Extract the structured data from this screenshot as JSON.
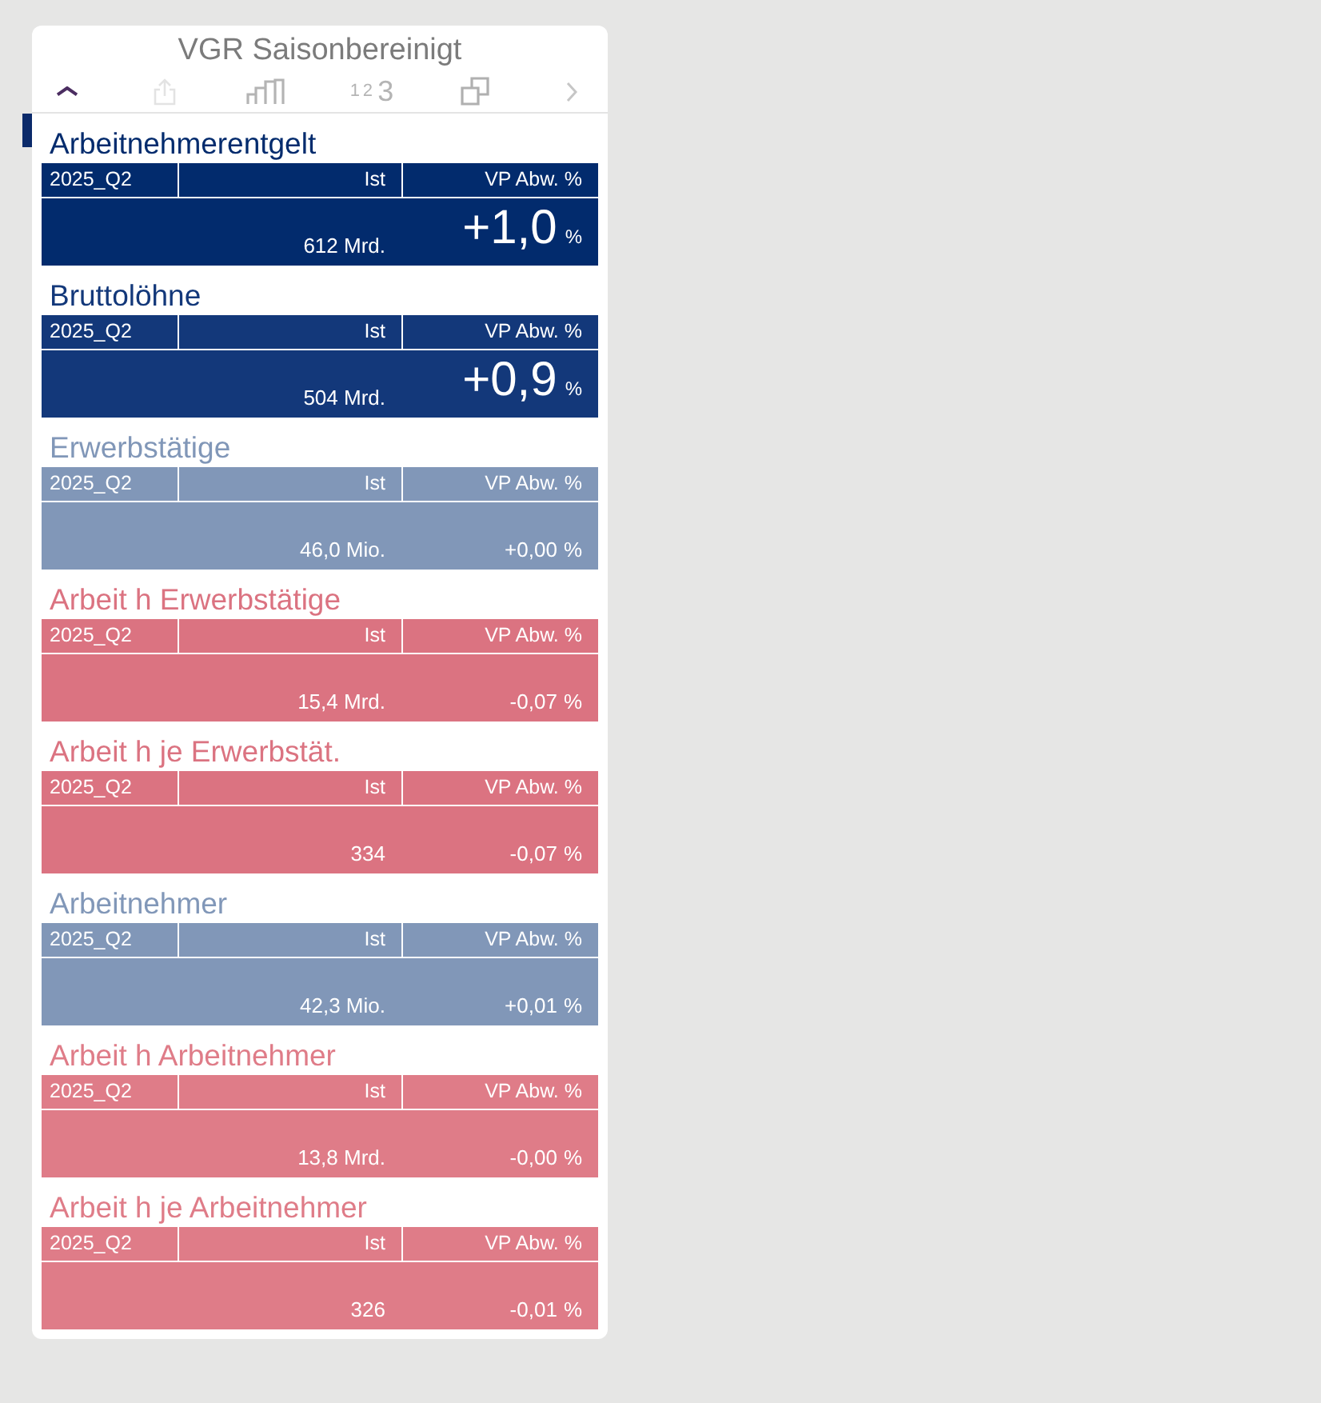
{
  "panel": {
    "title": "VGR Saisonbereinigt"
  },
  "toolbar": [
    {
      "kind": "collapse",
      "disabled": false
    },
    {
      "kind": "share",
      "disabled": true
    },
    {
      "kind": "chart",
      "disabled": false
    },
    {
      "kind": "number_format",
      "label": "$_{12}$3",
      "disabled": false
    },
    {
      "kind": "windows",
      "disabled": false
    },
    {
      "kind": "next",
      "disabled": false
    }
  ],
  "tiles": [
    {
      "title": "Arbeitnehmerentgelt",
      "color": "#022b6d",
      "selected": true,
      "emphasized": true,
      "columns": [
        "2025_Q2",
        "Ist",
        "VP Abw. %"
      ],
      "actual": "612 Mrd.",
      "deviation": "+1,0",
      "unit": "%"
    },
    {
      "title": "Bruttolöhne",
      "color": "#13387a",
      "selected": false,
      "emphasized": true,
      "columns": [
        "2025_Q2",
        "Ist",
        "VP Abw. %"
      ],
      "actual": "504 Mrd.",
      "deviation": "+0,9",
      "unit": "%"
    },
    {
      "title": "Erwerbstätige",
      "color": "#8197b8",
      "selected": false,
      "emphasized": false,
      "columns": [
        "2025_Q2",
        "Ist",
        "VP Abw. %"
      ],
      "actual": "46,0 Mio.",
      "deviation": "+0,00",
      "unit": "%"
    },
    {
      "title": "Arbeit h Erwerbstätige",
      "color": "#db7381",
      "selected": false,
      "emphasized": false,
      "columns": [
        "2025_Q2",
        "Ist",
        "VP Abw. %"
      ],
      "actual": "15,4 Mrd.",
      "deviation": "-0,07",
      "unit": "%"
    },
    {
      "title": "Arbeit h je Erwerbstät.",
      "color": "#db7381",
      "selected": false,
      "emphasized": false,
      "columns": [
        "2025_Q2",
        "Ist",
        "VP Abw. %"
      ],
      "actual": "334",
      "deviation": "-0,07",
      "unit": "%"
    },
    {
      "title": "Arbeitnehmer",
      "color": "#8197b8",
      "selected": false,
      "emphasized": false,
      "columns": [
        "2025_Q2",
        "Ist",
        "VP Abw. %"
      ],
      "actual": "42,3 Mio.",
      "deviation": "+0,01",
      "unit": "%"
    },
    {
      "title": "Arbeit h Arbeitnehmer",
      "color": "#df7c88",
      "selected": false,
      "emphasized": false,
      "columns": [
        "2025_Q2",
        "Ist",
        "VP Abw. %"
      ],
      "actual": "13,8 Mrd.",
      "deviation": "-0,00",
      "unit": "%"
    },
    {
      "title": "Arbeit h je Arbeitnehmer",
      "color": "#df7c88",
      "selected": false,
      "emphasized": false,
      "columns": [
        "2025_Q2",
        "Ist",
        "VP Abw. %"
      ],
      "actual": "326",
      "deviation": "-0,01",
      "unit": "%"
    }
  ]
}
